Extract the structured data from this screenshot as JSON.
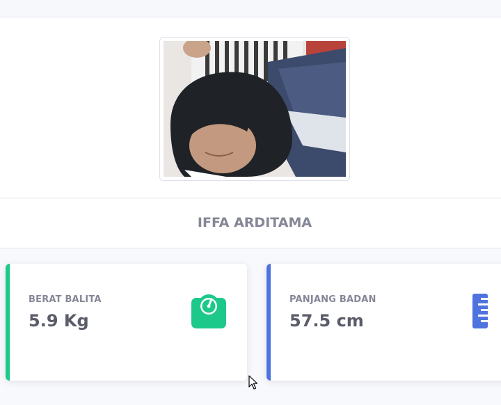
{
  "profile": {
    "name": "IFFA ARDITAMA"
  },
  "stats": {
    "weight": {
      "label": "BERAT BALITA",
      "value": "5.9 Kg",
      "icon": "scale-icon",
      "accent": "#1cc88a"
    },
    "length": {
      "label": "PANJANG BADAN",
      "value": "57.5 cm",
      "icon": "ruler-icon",
      "accent": "#4e73df"
    }
  },
  "colors": {
    "text_muted": "#858796",
    "text_dark": "#5a5c69",
    "border": "#e3e6f0"
  }
}
